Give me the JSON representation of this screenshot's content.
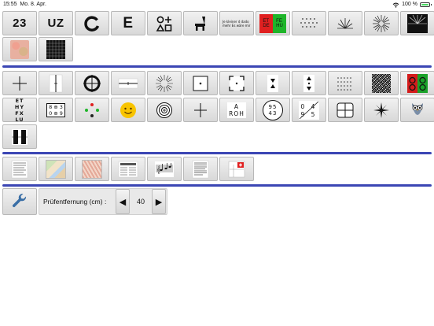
{
  "status": {
    "time": "15:55",
    "date": "Mo. 8. Apr.",
    "battery": "100 %",
    "battery_level": 1.0
  },
  "row1": [
    {
      "id": "numbers",
      "label": "23"
    },
    {
      "id": "letters",
      "label": "UZ"
    },
    {
      "id": "landolt",
      "label": ""
    },
    {
      "id": "e-hook",
      "label": "E"
    },
    {
      "id": "symbols",
      "label": ""
    },
    {
      "id": "child-picture",
      "label": ""
    },
    {
      "id": "reading-text",
      "label": "Je kleiner d dado mehr Es wäre mir"
    },
    {
      "id": "red-green",
      "label": "ETFE DEHU"
    },
    {
      "id": "dots",
      "label": ""
    },
    {
      "id": "half-star",
      "label": ""
    },
    {
      "id": "sunburst-light",
      "label": ""
    },
    {
      "id": "sunburst-dark",
      "label": ""
    }
  ],
  "row2": [
    {
      "id": "color-plate",
      "label": ""
    },
    {
      "id": "grid",
      "label": ""
    }
  ],
  "row3": [
    {
      "id": "cross",
      "label": ""
    },
    {
      "id": "vertical-line",
      "label": ""
    },
    {
      "id": "target-cross",
      "label": ""
    },
    {
      "id": "horizontal-line",
      "label": ""
    },
    {
      "id": "radial",
      "label": ""
    },
    {
      "id": "square-dot",
      "label": ""
    },
    {
      "id": "corner-frame",
      "label": ""
    },
    {
      "id": "triangles",
      "label": ""
    },
    {
      "id": "triangles-dot",
      "label": ""
    },
    {
      "id": "dot-grid",
      "label": ""
    },
    {
      "id": "stereo-noise",
      "label": ""
    },
    {
      "id": "red-green-circles",
      "label": ""
    }
  ],
  "row4": [
    {
      "id": "letter-chart",
      "label": "ET HY FX LU"
    },
    {
      "id": "digits-box",
      "label": "8 ⊕ 3 0 ⊕ 9"
    },
    {
      "id": "worth-dots",
      "label": ""
    },
    {
      "id": "smiley",
      "label": ""
    },
    {
      "id": "concentric",
      "label": ""
    },
    {
      "id": "plus-line",
      "label": ""
    },
    {
      "id": "aroh",
      "label": "A ROH"
    },
    {
      "id": "circle-digits",
      "label": "95 43"
    },
    {
      "id": "split-digits",
      "label": "0 4 9 5"
    },
    {
      "id": "rounded-cross",
      "label": ""
    },
    {
      "id": "star-burst",
      "label": ""
    },
    {
      "id": "owl",
      "label": ""
    }
  ],
  "row5": [
    {
      "id": "split-bars",
      "label": ""
    }
  ],
  "row6": [
    {
      "id": "text-page",
      "label": ""
    },
    {
      "id": "map",
      "label": ""
    },
    {
      "id": "map-red",
      "label": ""
    },
    {
      "id": "newspaper",
      "label": ""
    },
    {
      "id": "music-notes",
      "label": ""
    },
    {
      "id": "text-column",
      "label": ""
    },
    {
      "id": "swiss-card",
      "label": ""
    }
  ],
  "settings": {
    "distance_label": "Prüfentfernung (cm) :",
    "distance_value": "40",
    "decrease_glyph": "◀",
    "increase_glyph": "▶"
  },
  "colors": {
    "separator": "#3b46b4",
    "battery_green": "#4cd964",
    "wrench_blue": "#3a6fa6"
  }
}
